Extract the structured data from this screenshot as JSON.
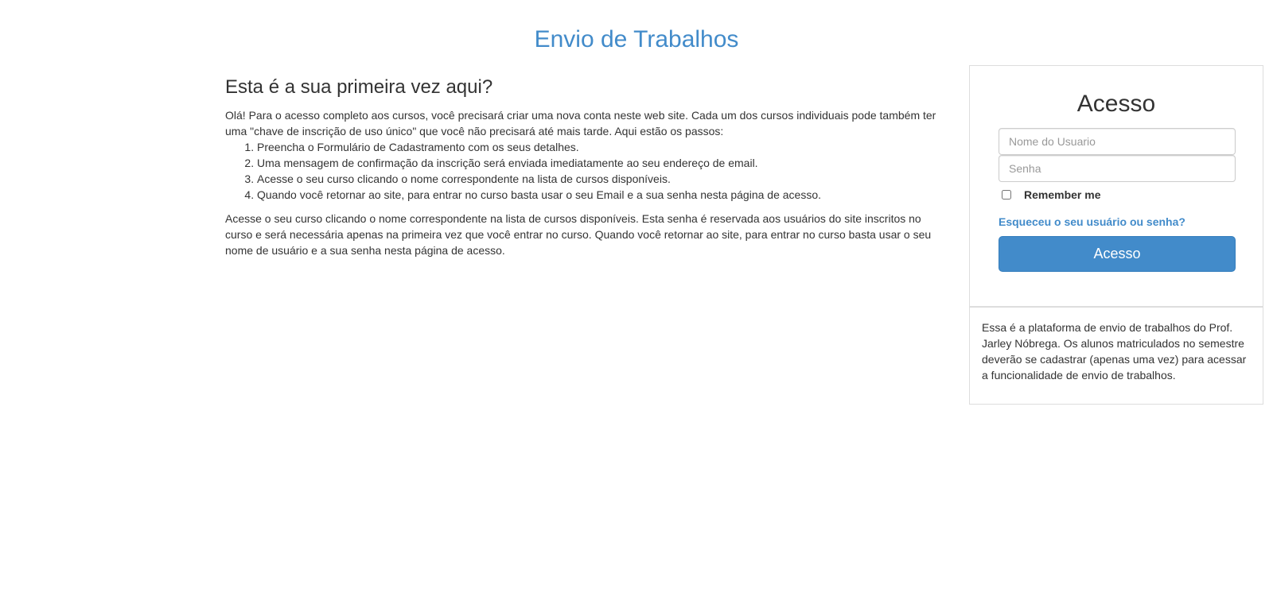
{
  "header": {
    "title": "Envio de Trabalhos"
  },
  "main": {
    "heading": "Esta é a sua primeira vez aqui?",
    "intro": "Olá! Para o acesso completo aos cursos, você precisará criar uma nova conta neste web site. Cada um dos cursos individuais pode também ter uma \"chave de inscrição de uso único\" que você não precisará até mais tarde. Aqui estão os passos:",
    "steps": [
      "Preencha o Formulário de Cadastramento com os seus detalhes.",
      "Uma mensagem de confirmação da inscrição será enviada imediatamente ao seu endereço de email.",
      "Acesse o seu curso clicando o nome correspondente na lista de cursos disponíveis.",
      "Quando você retornar ao site, para entrar no curso basta usar o seu Email e a sua senha nesta página de acesso."
    ],
    "closing": "Acesse o seu curso clicando o nome correspondente na lista de cursos disponíveis. Esta senha é reservada aos usuários do site inscritos no curso e será necessária apenas na primeira vez que você entrar no curso. Quando você retornar ao site, para entrar no curso basta usar o seu nome de usuário e a sua senha nesta página de acesso."
  },
  "login": {
    "title": "Acesso",
    "username_placeholder": "Nome do Usuario",
    "username_value": "",
    "password_placeholder": "Senha",
    "password_value": "",
    "remember_label": "Remember me",
    "remember_checked": false,
    "forgot_link": "Esqueceu o seu usuário ou senha?",
    "submit_label": "Acesso"
  },
  "info": {
    "text": "Essa é a plataforma de envio de trabalhos do Prof. Jarley Nóbrega. Os alunos matriculados no semestre deverão se cadastrar (apenas uma vez) para acessar a funcionalidade de envio de trabalhos."
  },
  "colors": {
    "accent": "#428bca",
    "text": "#333333",
    "border": "#dddddd"
  }
}
